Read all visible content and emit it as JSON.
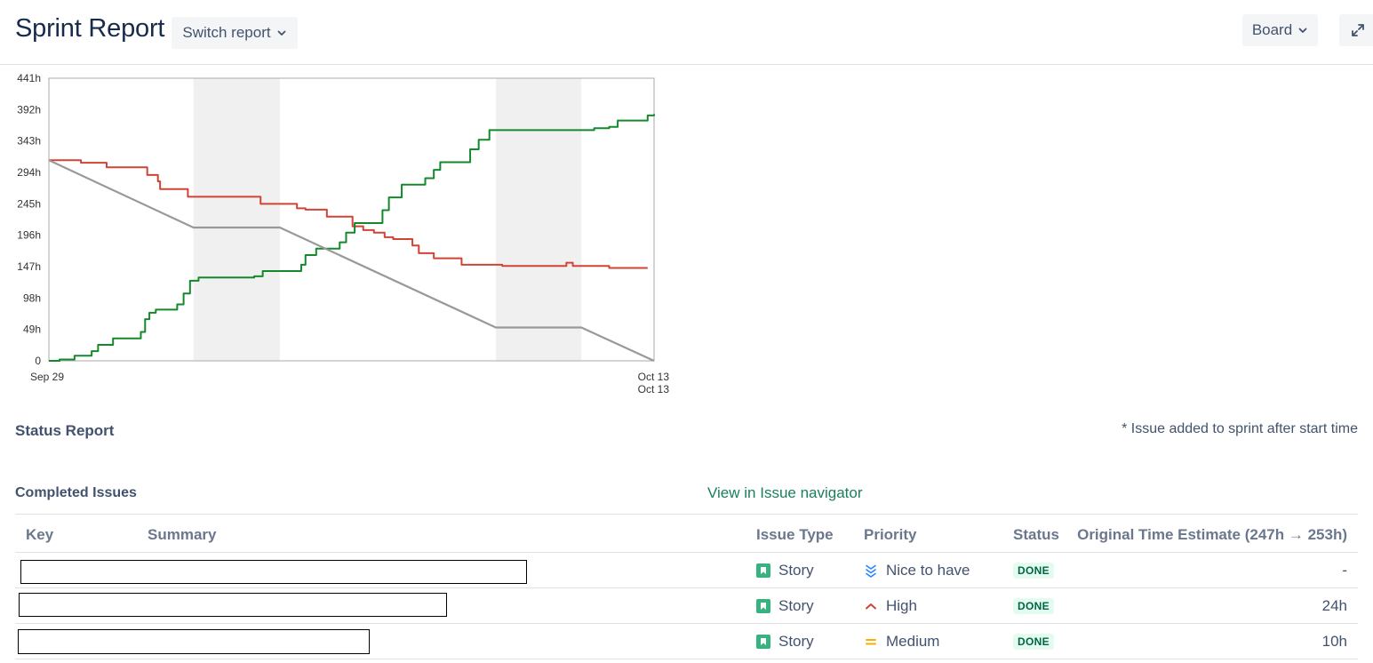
{
  "header": {
    "title": "Sprint Report",
    "switch_label": "Switch report",
    "board_label": "Board"
  },
  "chart_data": {
    "type": "line",
    "title": "",
    "xlabel": "",
    "ylabel": "",
    "x_ticks": [
      "Sep 29",
      "Oct 13",
      "Oct 13"
    ],
    "y_ticks": [
      "0",
      "49h",
      "98h",
      "147h",
      "196h",
      "245h",
      "294h",
      "343h",
      "392h",
      "441h"
    ],
    "ylim": [
      0,
      441
    ],
    "grid": false,
    "legend": "none",
    "non_working_days": [
      [
        5,
        7
      ],
      [
        12,
        14
      ]
    ],
    "xlim": [
      0,
      21
    ],
    "series": [
      {
        "color": "#d04437",
        "step": true,
        "points": [
          [
            0,
            313
          ],
          [
            1,
            313
          ],
          [
            1.5,
            309
          ],
          [
            2.6,
            309
          ],
          [
            2.7,
            302
          ],
          [
            4.5,
            302
          ],
          [
            4.6,
            290
          ],
          [
            5.1,
            280
          ],
          [
            5.2,
            268
          ],
          [
            6.4,
            268
          ],
          [
            6.5,
            256
          ],
          [
            7.1,
            256
          ],
          [
            9.8,
            256
          ],
          [
            9.9,
            245
          ],
          [
            11.5,
            245
          ],
          [
            11.6,
            238
          ],
          [
            12.0,
            236
          ],
          [
            12.8,
            236
          ],
          [
            13.0,
            225
          ],
          [
            14.1,
            225
          ],
          [
            14.2,
            210
          ],
          [
            14.6,
            210
          ],
          [
            14.7,
            204
          ],
          [
            15.2,
            200
          ],
          [
            15.7,
            193
          ],
          [
            16.1,
            190
          ],
          [
            16.8,
            190
          ],
          [
            17.0,
            180
          ],
          [
            17.3,
            168
          ],
          [
            18.0,
            160
          ],
          [
            19.0,
            160
          ],
          [
            19.3,
            150
          ],
          [
            21.0,
            150
          ],
          [
            21.2,
            148
          ],
          [
            24.0,
            148
          ],
          [
            24.2,
            153
          ],
          [
            24.5,
            148
          ],
          [
            26.2,
            145
          ],
          [
            28.0,
            145
          ]
        ]
      },
      {
        "color": "#14892c",
        "step": true,
        "points": [
          [
            0,
            0
          ],
          [
            0.5,
            2
          ],
          [
            1.2,
            8
          ],
          [
            2,
            15
          ],
          [
            2.3,
            25
          ],
          [
            3.0,
            35
          ],
          [
            4.1,
            35
          ],
          [
            4.3,
            45
          ],
          [
            4.5,
            65
          ],
          [
            4.7,
            75
          ],
          [
            5.0,
            80
          ],
          [
            5.8,
            80
          ],
          [
            6.0,
            88
          ],
          [
            6.3,
            105
          ],
          [
            6.6,
            125
          ],
          [
            7.0,
            130
          ],
          [
            7.5,
            130
          ],
          [
            9.6,
            132
          ],
          [
            10.0,
            140
          ],
          [
            11.5,
            140
          ],
          [
            11.8,
            150
          ],
          [
            12.0,
            165
          ],
          [
            12.5,
            175
          ],
          [
            13.2,
            175
          ],
          [
            13.6,
            185
          ],
          [
            13.9,
            200
          ],
          [
            14.3,
            215
          ],
          [
            15.2,
            215
          ],
          [
            15.6,
            235
          ],
          [
            15.9,
            255
          ],
          [
            16.5,
            275
          ],
          [
            17.3,
            275
          ],
          [
            17.6,
            285
          ],
          [
            18.0,
            298
          ],
          [
            18.3,
            310
          ],
          [
            19.5,
            310
          ],
          [
            19.7,
            330
          ],
          [
            20.1,
            345
          ],
          [
            20.6,
            360
          ],
          [
            25.0,
            360
          ],
          [
            25.5,
            363
          ],
          [
            26.2,
            365
          ],
          [
            26.6,
            375
          ],
          [
            27.8,
            375
          ],
          [
            28.0,
            383
          ],
          [
            28.3,
            385
          ]
        ]
      },
      {
        "color": "#999999",
        "step": false,
        "points": [
          [
            0,
            313
          ],
          [
            6.76,
            208
          ],
          [
            10.8,
            208
          ],
          [
            20.9,
            52
          ],
          [
            24.9,
            52
          ],
          [
            28.3,
            0
          ]
        ]
      }
    ]
  },
  "status_report": {
    "title": "Status Report",
    "note": "* Issue added to sprint after start time",
    "completed_title": "Completed Issues",
    "navigator_link": "View in Issue navigator",
    "columns": {
      "key": "Key",
      "summary": "Summary",
      "issue_type": "Issue Type",
      "priority": "Priority",
      "status": "Status",
      "estimate": "Original Time Estimate (247h → 253h)"
    },
    "rows": [
      {
        "issue_type": "Story",
        "priority": "Nice to have",
        "priority_icon": "lowest-priority-icon",
        "status": "DONE",
        "estimate": "-"
      },
      {
        "issue_type": "Story",
        "priority": "High",
        "priority_icon": "high-priority-icon",
        "status": "DONE",
        "estimate": "24h"
      },
      {
        "issue_type": "Story",
        "priority": "Medium",
        "priority_icon": "medium-priority-icon",
        "status": "DONE",
        "estimate": "10h"
      }
    ]
  }
}
